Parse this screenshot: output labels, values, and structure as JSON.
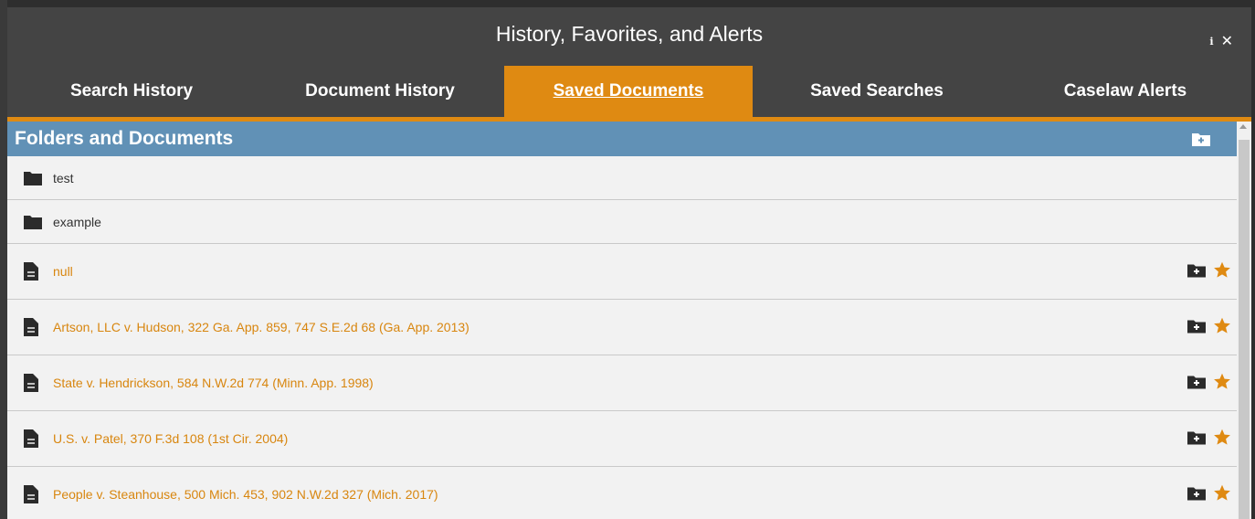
{
  "dialog": {
    "title": "History, Favorites, and Alerts",
    "info_glyph": "i",
    "close_glyph": "✕"
  },
  "tabs": [
    {
      "label": "Search History",
      "active": false
    },
    {
      "label": "Document History",
      "active": false
    },
    {
      "label": "Saved Documents",
      "active": true
    },
    {
      "label": "Saved Searches",
      "active": false
    },
    {
      "label": "Caselaw Alerts",
      "active": false
    }
  ],
  "section": {
    "title": "Folders and Documents",
    "add_folder_icon": "folder-plus-icon"
  },
  "folders": [
    {
      "name": "test",
      "icon": "folder-icon"
    },
    {
      "name": "example",
      "icon": "folder-icon"
    }
  ],
  "documents": [
    {
      "title": "null",
      "icon": "document-icon"
    },
    {
      "title": "Artson, LLC v. Hudson, 322 Ga. App. 859, 747 S.E.2d 68 (Ga. App. 2013)",
      "icon": "document-icon"
    },
    {
      "title": "State v. Hendrickson, 584 N.W.2d 774 (Minn. App. 1998)",
      "icon": "document-icon"
    },
    {
      "title": "U.S. v. Patel, 370 F.3d 108 (1st Cir. 2004)",
      "icon": "document-icon"
    },
    {
      "title": "People v. Steanhouse, 500 Mich. 453, 902 N.W.2d 327 (Mich. 2017)",
      "icon": "document-icon"
    }
  ],
  "colors": {
    "accent": "#df8a12",
    "header_bar": "#444444",
    "section_header": "#6191b6",
    "link": "#d8860f"
  }
}
